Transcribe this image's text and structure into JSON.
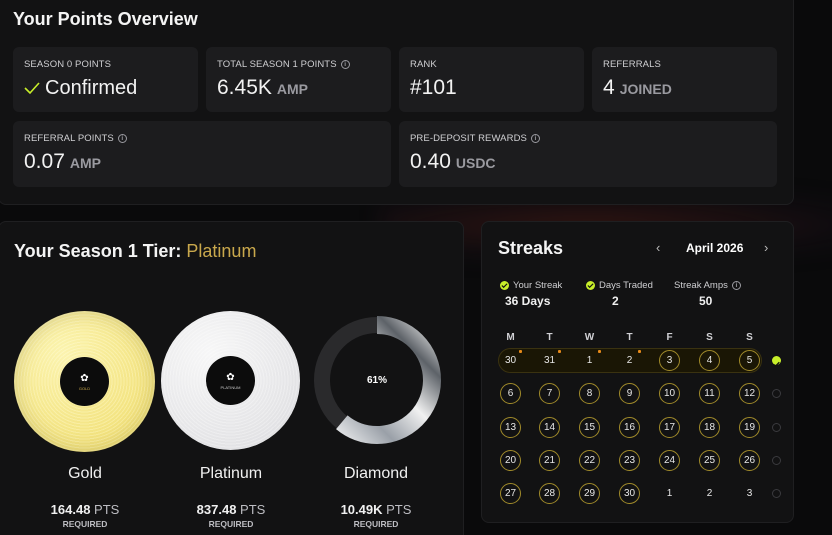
{
  "overview": {
    "title": "Your Points Overview",
    "cards": [
      {
        "label": "SEASON 0 POINTS",
        "value": "Confirmed",
        "unit": "",
        "info": false,
        "check": true
      },
      {
        "label": "TOTAL SEASON 1 POINTS",
        "value": "6.45K",
        "unit": "AMP",
        "info": true
      },
      {
        "label": "RANK",
        "value": "#101",
        "unit": "",
        "info": false
      },
      {
        "label": "REFERRALS",
        "value": "4",
        "unit": "JOINED",
        "info": false
      },
      {
        "label": "REFERRAL POINTS",
        "value": "0.07",
        "unit": "AMP",
        "info": true
      },
      {
        "label": "PRE-DEPOSIT REWARDS",
        "value": "0.40",
        "unit": "USDC",
        "info": true
      }
    ]
  },
  "tier": {
    "title_prefix": "Your Season 1 Tier:",
    "tier_name": "Platinum",
    "accent": "#c9a84c",
    "discs": [
      {
        "name": "Gold",
        "points": "164.48",
        "unit": "PTS",
        "required": "REQUIRED",
        "label_text": "GOLD"
      },
      {
        "name": "Platinum",
        "points": "837.48",
        "unit": "PTS",
        "required": "REQUIRED",
        "label_text": "PLATINUM"
      },
      {
        "name": "Diamond",
        "points": "10.49K",
        "unit": "PTS",
        "required": "REQUIRED",
        "progress_text": "61%",
        "progress": 0.61
      }
    ]
  },
  "streaks": {
    "title": "Streaks",
    "month": "April 2026",
    "stats": [
      {
        "label": "Your Streak",
        "value": "36 Days"
      },
      {
        "label": "Days Traded",
        "value": "2"
      },
      {
        "label": "Streak Amps",
        "value": "50"
      }
    ],
    "weekdays": [
      "M",
      "T",
      "W",
      "T",
      "F",
      "S",
      "S"
    ],
    "weeks": [
      [
        "30",
        "31",
        "1",
        "2",
        "3",
        "4",
        "5"
      ],
      [
        "6",
        "7",
        "8",
        "9",
        "10",
        "11",
        "12"
      ],
      [
        "13",
        "14",
        "15",
        "16",
        "17",
        "18",
        "19"
      ],
      [
        "20",
        "21",
        "22",
        "23",
        "24",
        "25",
        "26"
      ],
      [
        "27",
        "28",
        "29",
        "30",
        "1",
        "2",
        "3"
      ]
    ],
    "accent": "#c8ef2a"
  }
}
